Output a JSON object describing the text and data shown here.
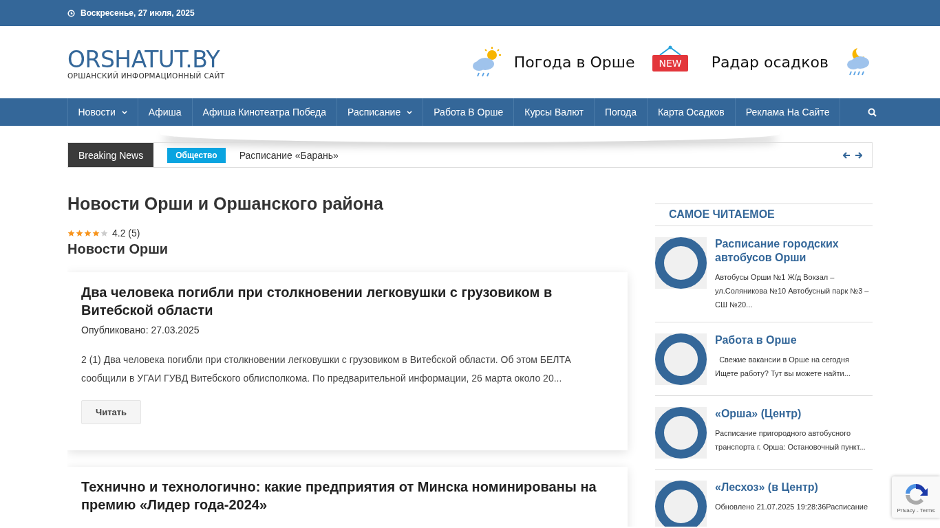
{
  "top_bar": {
    "date": "Воскресенье, 27 июля, 2025"
  },
  "header": {
    "logo": "ORSHATUT.BY",
    "tagline": "ОРШАНСКИЙ ИНФОРМАЦИОННЫЙ САЙТ",
    "weather_link": "Погода в Орше",
    "badge": "NEW",
    "radar_link": "Радар осадков"
  },
  "nav": {
    "items": [
      {
        "label": "Новости",
        "has_menu": true
      },
      {
        "label": "Афиша",
        "has_menu": false
      },
      {
        "label": "Афиша Кинотеатра Победа",
        "has_menu": false
      },
      {
        "label": "Расписание",
        "has_menu": true
      },
      {
        "label": "Работа В Орше",
        "has_menu": false
      },
      {
        "label": "Курсы Валют",
        "has_menu": false
      },
      {
        "label": "Погода",
        "has_menu": false
      },
      {
        "label": "Карта Осадков",
        "has_menu": false
      },
      {
        "label": "Реклама На Сайте",
        "has_menu": false
      }
    ]
  },
  "breaking": {
    "label": "Breaking News",
    "category": "Общество",
    "headline": "Расписание «Барань»"
  },
  "page": {
    "title": "Новости Орши и Оршанского района",
    "stars": 4,
    "rating": "4.2 (5)",
    "subtitle": "Новости Орши"
  },
  "articles": [
    {
      "title": "Два человека погибли при столкновении легковушки с грузовиком в Витебской области",
      "date": "Опубликовано: 27.03.2025",
      "excerpt": "2 (1) Два человека погибли при столкновении легковушки с грузовиком в Витебской области. Об этом БЕЛТА сообщили в УГАИ ГУВД Витебского облисполкома. По предварительной информации, 26 марта около 20...",
      "button": "Читать"
    },
    {
      "title": "Технично и технологично: какие предприятия от Минска номинированы на премию «Лидер года-2024»"
    }
  ],
  "sidebar": {
    "title": "САМОЕ ЧИТАЕМОЕ",
    "items": [
      {
        "title": "Расписание городских автобусов Орши",
        "excerpt": "Автобусы Орши №1 Ж/д Вокзал – ул.Соляникова №10 Автобусный парк №3 – СШ №20..."
      },
      {
        "title": "Работа в Орше",
        "excerpt": "  Свежие вакансии в Орше на сегодня Ищете работу? Тут вы можете найти..."
      },
      {
        "title": "«Орша» (Центр)",
        "excerpt": "Расписание пригородного автобусного транспорта г. Орша: Остановочный пункт..."
      },
      {
        "title": "«Лесхоз» (в Центр)",
        "excerpt": "Обновлено 21.07.2025 19:28:36Расписание"
      }
    ]
  },
  "recaptcha": {
    "links": "Privacy - Terms"
  }
}
